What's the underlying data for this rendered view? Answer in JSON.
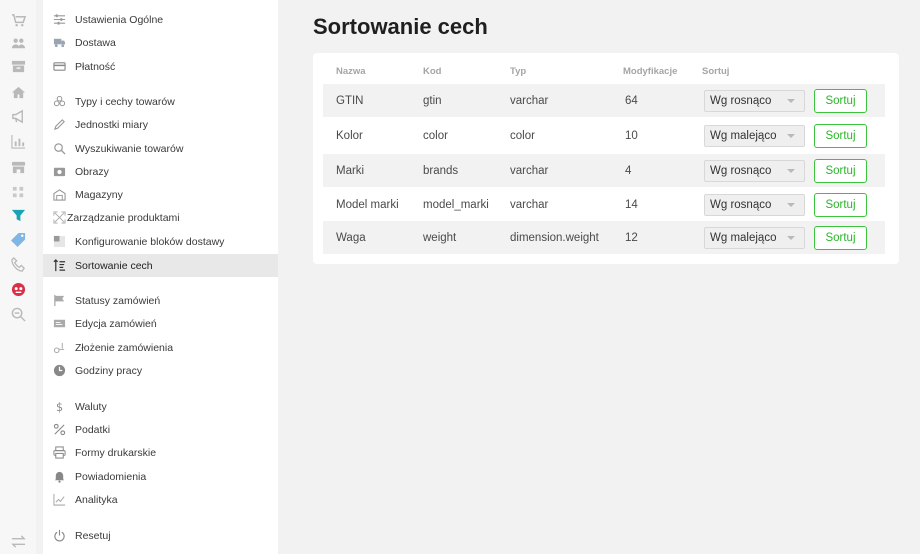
{
  "rail": {
    "icons": [
      {
        "name": "cart-icon",
        "active": false
      },
      {
        "name": "users-icon",
        "active": false
      },
      {
        "name": "archive-icon",
        "active": false
      },
      {
        "name": "home-icon",
        "active": false
      },
      {
        "name": "megaphone-icon",
        "active": false
      },
      {
        "name": "bar-chart-icon",
        "active": false
      },
      {
        "name": "store-icon",
        "active": false
      },
      {
        "name": "grid-icon",
        "active": false
      },
      {
        "name": "filter-icon",
        "active": true
      },
      {
        "name": "tag-icon",
        "active": false
      },
      {
        "name": "phone-icon",
        "active": false
      },
      {
        "name": "badge-icon",
        "active": false
      },
      {
        "name": "zoom-out-icon",
        "active": false
      },
      {
        "name": "swap-arrows-icon",
        "active": false
      }
    ]
  },
  "sidebar": {
    "items": [
      {
        "label": "Ustawienia Ogólne",
        "icon": "sliders-icon"
      },
      {
        "label": "Dostawa",
        "icon": "truck-icon"
      },
      {
        "label": "Płatność",
        "icon": "credit-card-icon"
      },
      {
        "label": "Typy i cechy towarów",
        "icon": "cubes-icon"
      },
      {
        "label": "Jednostki miary",
        "icon": "pencil-icon"
      },
      {
        "label": "Wyszukiwanie towarów",
        "icon": "search-icon"
      },
      {
        "label": "Obrazy",
        "icon": "camera-icon"
      },
      {
        "label": "Magazyny",
        "icon": "warehouse-icon"
      },
      {
        "label": "Zarządzanie produktami",
        "icon": "expand-icon"
      },
      {
        "label": "Konfigurowanie bloków dostawy",
        "icon": "blocks-icon"
      },
      {
        "label": "Sortowanie cech",
        "icon": "sort-icon"
      },
      {
        "label": "Statusy zamówień",
        "icon": "flag-icon"
      },
      {
        "label": "Edycja zamówień",
        "icon": "edit-order-icon"
      },
      {
        "label": "Złożenie zamówienia",
        "icon": "checkout-icon"
      },
      {
        "label": "Godziny pracy",
        "icon": "clock-icon"
      },
      {
        "label": "Waluty",
        "icon": "dollar-icon"
      },
      {
        "label": "Podatki",
        "icon": "percent-icon"
      },
      {
        "label": "Formy drukarskie",
        "icon": "printer-icon"
      },
      {
        "label": "Powiadomienia",
        "icon": "bell-icon"
      },
      {
        "label": "Analityka",
        "icon": "line-chart-icon"
      },
      {
        "label": "Resetuj",
        "icon": "power-icon"
      }
    ],
    "active": "Sortowanie cech"
  },
  "main": {
    "title": "Sortowanie cech",
    "columns": [
      "Nazwa",
      "Kod",
      "Typ",
      "Modyfikacje",
      "Sortuj"
    ],
    "rows": [
      {
        "name": "GTIN",
        "code": "gtin",
        "type": "varchar",
        "modifications": "64",
        "sort": "Wg rosnąco",
        "button": "Sortuj"
      },
      {
        "name": "Kolor",
        "code": "color",
        "type": "color",
        "modifications": "10",
        "sort": "Wg malejąco",
        "button": "Sortuj"
      },
      {
        "name": "Marki",
        "code": "brands",
        "type": "varchar",
        "modifications": "4",
        "sort": "Wg rosnąco",
        "button": "Sortuj"
      },
      {
        "name": "Model marki",
        "code": "model_marki",
        "type": "varchar",
        "modifications": "14",
        "sort": "Wg rosnąco",
        "button": "Sortuj"
      },
      {
        "name": "Waga",
        "code": "weight",
        "type": "dimension.weight",
        "modifications": "12",
        "sort": "Wg malejąco",
        "button": "Sortuj"
      }
    ]
  },
  "colors": {
    "accent_green": "#3cc43c",
    "active_filter": "#1aa3b5",
    "badge_red": "#d9304a",
    "icon_gray": "#b9b9b9"
  }
}
